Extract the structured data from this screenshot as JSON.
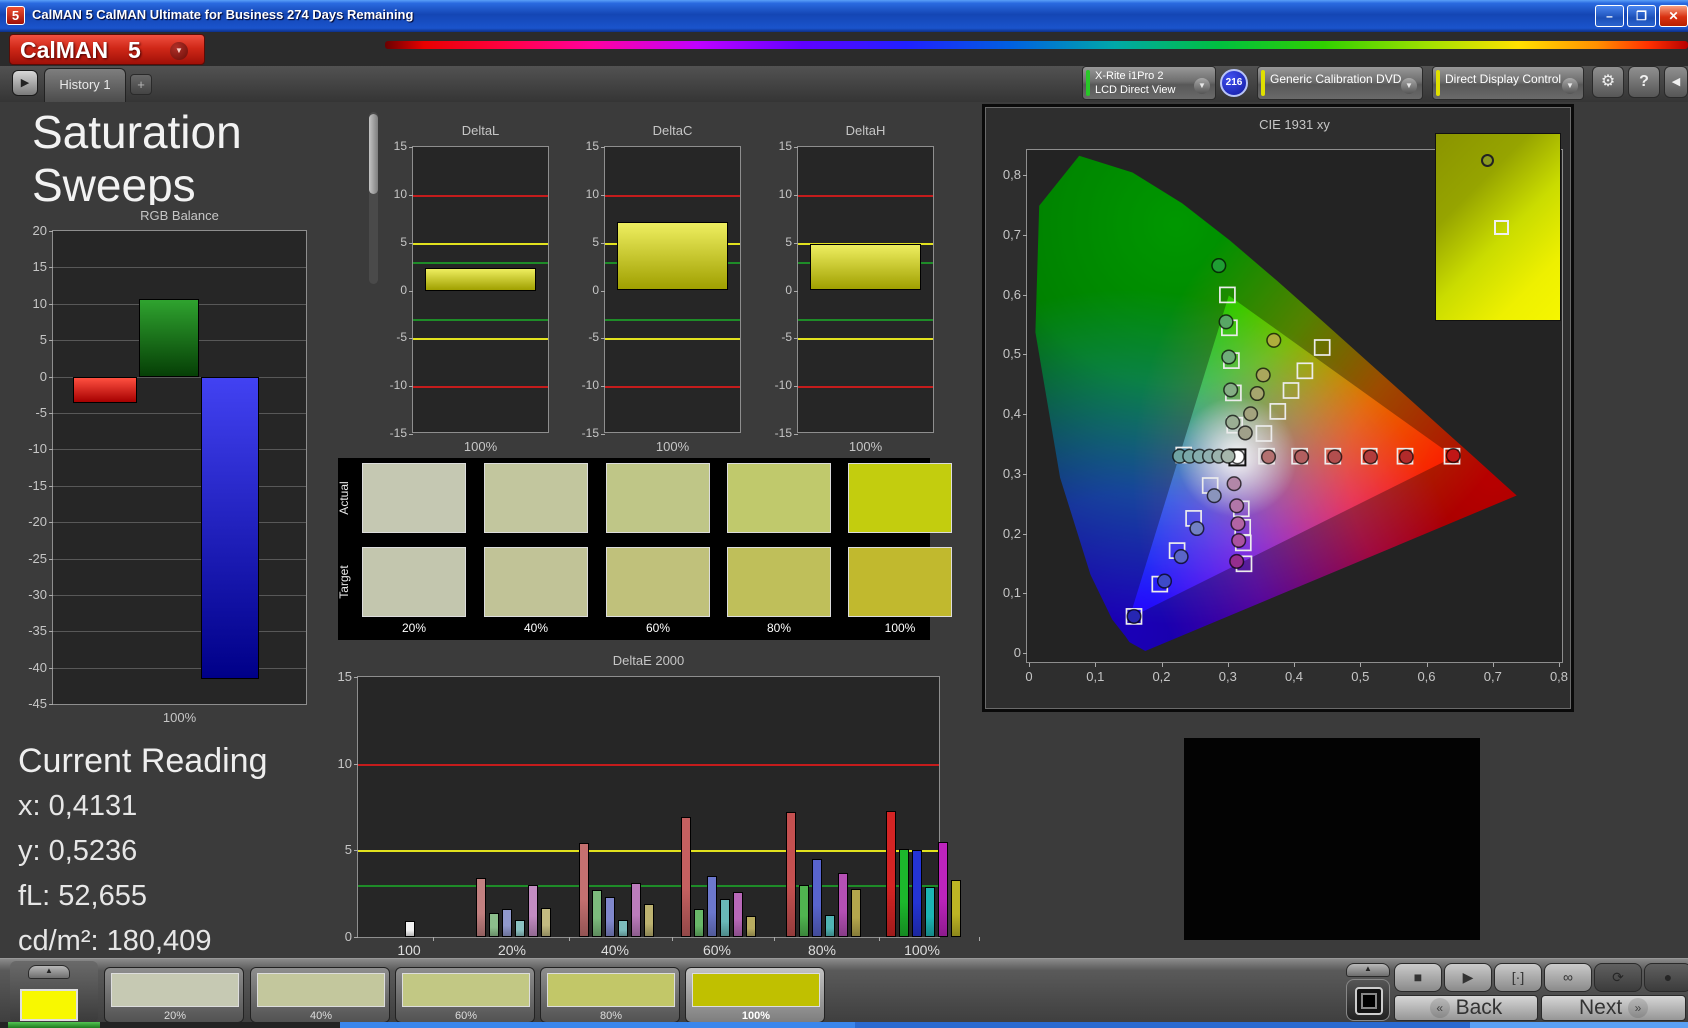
{
  "window": {
    "icon_label": "5",
    "title": "CalMAN 5 CalMAN Ultimate for Business 274 Days Remaining"
  },
  "logo": {
    "brand": "CalMAN",
    "version": "5"
  },
  "nav": {
    "history_tab": "History 1",
    "add_tab": "+"
  },
  "toolbar": {
    "meter_line1": "X-Rite i1Pro 2",
    "meter_line2": "LCD Direct View",
    "meter_badge": "216",
    "source_label": "Generic Calibration DVD",
    "display_label": "Direct Display Control",
    "help_label": "?"
  },
  "page": {
    "title_line1": "Saturation",
    "title_line2": "Sweeps"
  },
  "current_reading": {
    "heading": "Current Reading",
    "lines": [
      "x: 0,4131",
      "y: 0,5236",
      "fL: 52,655",
      "cd/m²: 180,409"
    ]
  },
  "chart_data": {
    "rgb_balance": {
      "type": "bar",
      "title": "RGB Balance",
      "xlabel": "100%",
      "ylim": [
        -45,
        20
      ],
      "ytick_step": 5,
      "yticks": [
        20,
        15,
        10,
        5,
        0,
        -5,
        -10,
        -15,
        -20,
        -25,
        -30,
        -35,
        -40,
        -45
      ],
      "categories": [
        "Red",
        "Green",
        "Blue"
      ],
      "values": [
        -3.7,
        10.7,
        -41.5
      ],
      "bar_colors_top": [
        "#ff5040",
        "#2fa32f",
        "#4242f2"
      ],
      "bar_colors_bottom": [
        "#a60000",
        "#063f06",
        "#000088"
      ]
    },
    "delta_sweeps": {
      "type": "bar",
      "ylim": [
        -15,
        15
      ],
      "yticks": [
        15,
        10,
        5,
        0,
        -5,
        -10,
        -15
      ],
      "xlabel": "100%",
      "bar_color_top": "#eeee60",
      "bar_color_bottom": "#a0a000",
      "ref_lines": [
        {
          "value": 10,
          "color": "#c41c1c"
        },
        {
          "value": -10,
          "color": "#c41c1c"
        },
        {
          "value": 5,
          "color": "#e2e21e"
        },
        {
          "value": -5,
          "color": "#e2e21e"
        },
        {
          "value": 3,
          "color": "#1e8c28"
        },
        {
          "value": -3,
          "color": "#1e8c28"
        }
      ],
      "charts": [
        {
          "title": "DeltaL",
          "value": 2.4
        },
        {
          "title": "DeltaC",
          "value": 7.2
        },
        {
          "title": "DeltaH",
          "value": 4.9
        }
      ]
    },
    "color_checker": {
      "type": "table",
      "row_labels": [
        "Actual",
        "Target"
      ],
      "col_labels": [
        "20%",
        "40%",
        "60%",
        "80%",
        "100%"
      ],
      "actual_colors": [
        "#c5c8b2",
        "#c2c69e",
        "#bfc687",
        "#c0c96c",
        "#c3cd0e"
      ],
      "target_colors": [
        "#c3c6ae",
        "#c1c397",
        "#c0c17b",
        "#bfbf5a",
        "#c1b92e"
      ]
    },
    "deltae_2000": {
      "type": "bar",
      "title": "DeltaE 2000",
      "ylim": [
        0,
        15
      ],
      "yticks": [
        15,
        10,
        5,
        0
      ],
      "ref_lines": [
        {
          "value": 10,
          "color": "#c41c1c"
        },
        {
          "value": 5,
          "color": "#e2e21e"
        },
        {
          "value": 3,
          "color": "#1e8c28"
        }
      ],
      "groups": [
        {
          "label": "100",
          "values": [
            0.9
          ],
          "colors": [
            "#f0f0f0"
          ]
        },
        {
          "label": "20%",
          "values": [
            3.4,
            1.4,
            1.6,
            1.0,
            3.0,
            1.7
          ],
          "colors": [
            "#c28080",
            "#8cbe8c",
            "#9098cc",
            "#8cc2c2",
            "#c28cc2",
            "#c2ba80"
          ]
        },
        {
          "label": "40%",
          "values": [
            5.4,
            2.7,
            2.3,
            1.0,
            3.1,
            1.9
          ],
          "colors": [
            "#c47070",
            "#7cba7c",
            "#8088cc",
            "#7cbcbc",
            "#bc7cbc",
            "#bcb270"
          ]
        },
        {
          "label": "60%",
          "values": [
            6.9,
            1.6,
            3.5,
            2.2,
            2.6,
            1.2
          ],
          "colors": [
            "#c46060",
            "#68b868",
            "#6c78cc",
            "#68b8b8",
            "#b868b8",
            "#b8ac60"
          ]
        },
        {
          "label": "80%",
          "values": [
            7.2,
            3.0,
            4.5,
            1.3,
            3.7,
            2.8
          ],
          "colors": [
            "#c45050",
            "#50b450",
            "#5864cc",
            "#50b4b4",
            "#b450b4",
            "#b4a64c"
          ]
        },
        {
          "label": "100%",
          "values": [
            7.3,
            5.1,
            5.0,
            2.9,
            5.5,
            3.3
          ],
          "colors": [
            "#d42424",
            "#1cb82c",
            "#2434d4",
            "#1cb4b4",
            "#bc24bc",
            "#bcb424"
          ]
        }
      ]
    },
    "cie_1931": {
      "type": "scatter",
      "title": "CIE 1931 xy",
      "x_ticks": [
        "0",
        "0,1",
        "0,2",
        "0,3",
        "0,4",
        "0,5",
        "0,6",
        "0,7",
        "0,8"
      ],
      "y_ticks": [
        "0",
        "0,1",
        "0,2",
        "0,3",
        "0,4",
        "0,5",
        "0,6",
        "0,7",
        "0,8"
      ],
      "gamut_triangle": [
        [
          0.64,
          0.33
        ],
        [
          0.3,
          0.6
        ],
        [
          0.15,
          0.06
        ]
      ],
      "white_point_target": [
        0.313,
        0.329
      ],
      "targets": [
        [
          0.357,
          0.331
        ],
        [
          0.407,
          0.331
        ],
        [
          0.457,
          0.331
        ],
        [
          0.512,
          0.331
        ],
        [
          0.566,
          0.331
        ],
        [
          0.637,
          0.331
        ],
        [
          0.298,
          0.601
        ],
        [
          0.301,
          0.546
        ],
        [
          0.304,
          0.491
        ],
        [
          0.307,
          0.437
        ],
        [
          0.309,
          0.383
        ],
        [
          0.272,
          0.282
        ],
        [
          0.247,
          0.227
        ],
        [
          0.222,
          0.173
        ],
        [
          0.196,
          0.117
        ],
        [
          0.157,
          0.063
        ],
        [
          0.319,
          0.243
        ],
        [
          0.321,
          0.212
        ],
        [
          0.322,
          0.186
        ],
        [
          0.323,
          0.151
        ],
        [
          0.353,
          0.369
        ],
        [
          0.374,
          0.406
        ],
        [
          0.394,
          0.441
        ],
        [
          0.415,
          0.474
        ],
        [
          0.441,
          0.513
        ],
        [
          0.232,
          0.333
        ]
      ],
      "measurements": [
        {
          "x": 0.313,
          "y": 0.33,
          "color": "#ffffff"
        },
        {
          "x": 0.285,
          "y": 0.65,
          "color": "#1f9e33"
        },
        {
          "x": 0.296,
          "y": 0.556,
          "color": "#58a765"
        },
        {
          "x": 0.3,
          "y": 0.497,
          "color": "#6fae79"
        },
        {
          "x": 0.303,
          "y": 0.442,
          "color": "#85ae85"
        },
        {
          "x": 0.306,
          "y": 0.388,
          "color": "#9aae94"
        },
        {
          "x": 0.368,
          "y": 0.525,
          "color": "#aeae3c"
        },
        {
          "x": 0.352,
          "y": 0.467,
          "color": "#aaa75c"
        },
        {
          "x": 0.343,
          "y": 0.436,
          "color": "#a6a66e"
        },
        {
          "x": 0.333,
          "y": 0.402,
          "color": "#a3a37e"
        },
        {
          "x": 0.325,
          "y": 0.37,
          "color": "#a0a08a"
        },
        {
          "x": 0.36,
          "y": 0.33,
          "color": "#b37070"
        },
        {
          "x": 0.41,
          "y": 0.33,
          "color": "#b25f5f"
        },
        {
          "x": 0.46,
          "y": 0.33,
          "color": "#b24e4e"
        },
        {
          "x": 0.514,
          "y": 0.33,
          "color": "#b23c3c"
        },
        {
          "x": 0.568,
          "y": 0.33,
          "color": "#b22a2a"
        },
        {
          "x": 0.639,
          "y": 0.332,
          "color": "#c01616"
        },
        {
          "x": 0.226,
          "y": 0.331,
          "color": "#6fa3a3"
        },
        {
          "x": 0.241,
          "y": 0.331,
          "color": "#7aa8a8"
        },
        {
          "x": 0.256,
          "y": 0.331,
          "color": "#85adad"
        },
        {
          "x": 0.271,
          "y": 0.331,
          "color": "#90b0b0"
        },
        {
          "x": 0.285,
          "y": 0.331,
          "color": "#9bb3ae"
        },
        {
          "x": 0.299,
          "y": 0.331,
          "color": "#a6b6ac"
        },
        {
          "x": 0.308,
          "y": 0.285,
          "color": "#b287a8"
        },
        {
          "x": 0.312,
          "y": 0.248,
          "color": "#b276a8"
        },
        {
          "x": 0.314,
          "y": 0.218,
          "color": "#b264a4"
        },
        {
          "x": 0.315,
          "y": 0.19,
          "color": "#aa52a0"
        },
        {
          "x": 0.312,
          "y": 0.155,
          "color": "#962e8e"
        },
        {
          "x": 0.278,
          "y": 0.265,
          "color": "#8a94bc"
        },
        {
          "x": 0.252,
          "y": 0.21,
          "color": "#7280c4"
        },
        {
          "x": 0.228,
          "y": 0.163,
          "color": "#5a64c8"
        },
        {
          "x": 0.203,
          "y": 0.122,
          "color": "#3e4ac8"
        },
        {
          "x": 0.157,
          "y": 0.063,
          "color": "#2626b2"
        }
      ],
      "inset_marker_color": "#8a9a20"
    }
  },
  "bottom_bar": {
    "mini_swatch_color": "#f8f800",
    "patterns": [
      {
        "label": "20%",
        "color": "#c6c9b3",
        "active": false
      },
      {
        "label": "40%",
        "color": "#c3c79d",
        "active": false
      },
      {
        "label": "60%",
        "color": "#c2c884",
        "active": false
      },
      {
        "label": "80%",
        "color": "#c2c768",
        "active": false
      },
      {
        "label": "100%",
        "color": "#c0c000",
        "active": true
      }
    ],
    "transport": [
      {
        "name": "stop",
        "glyph": "■",
        "enabled": true
      },
      {
        "name": "play",
        "glyph": "▶",
        "enabled": true
      },
      {
        "name": "frame-advance",
        "glyph": "[·]",
        "enabled": true
      },
      {
        "name": "loop",
        "glyph": "∞",
        "enabled": true
      },
      {
        "name": "refresh",
        "glyph": "⟳",
        "enabled": false
      },
      {
        "name": "record",
        "glyph": "●",
        "enabled": false
      }
    ],
    "back_label": "Back",
    "next_label": "Next"
  }
}
